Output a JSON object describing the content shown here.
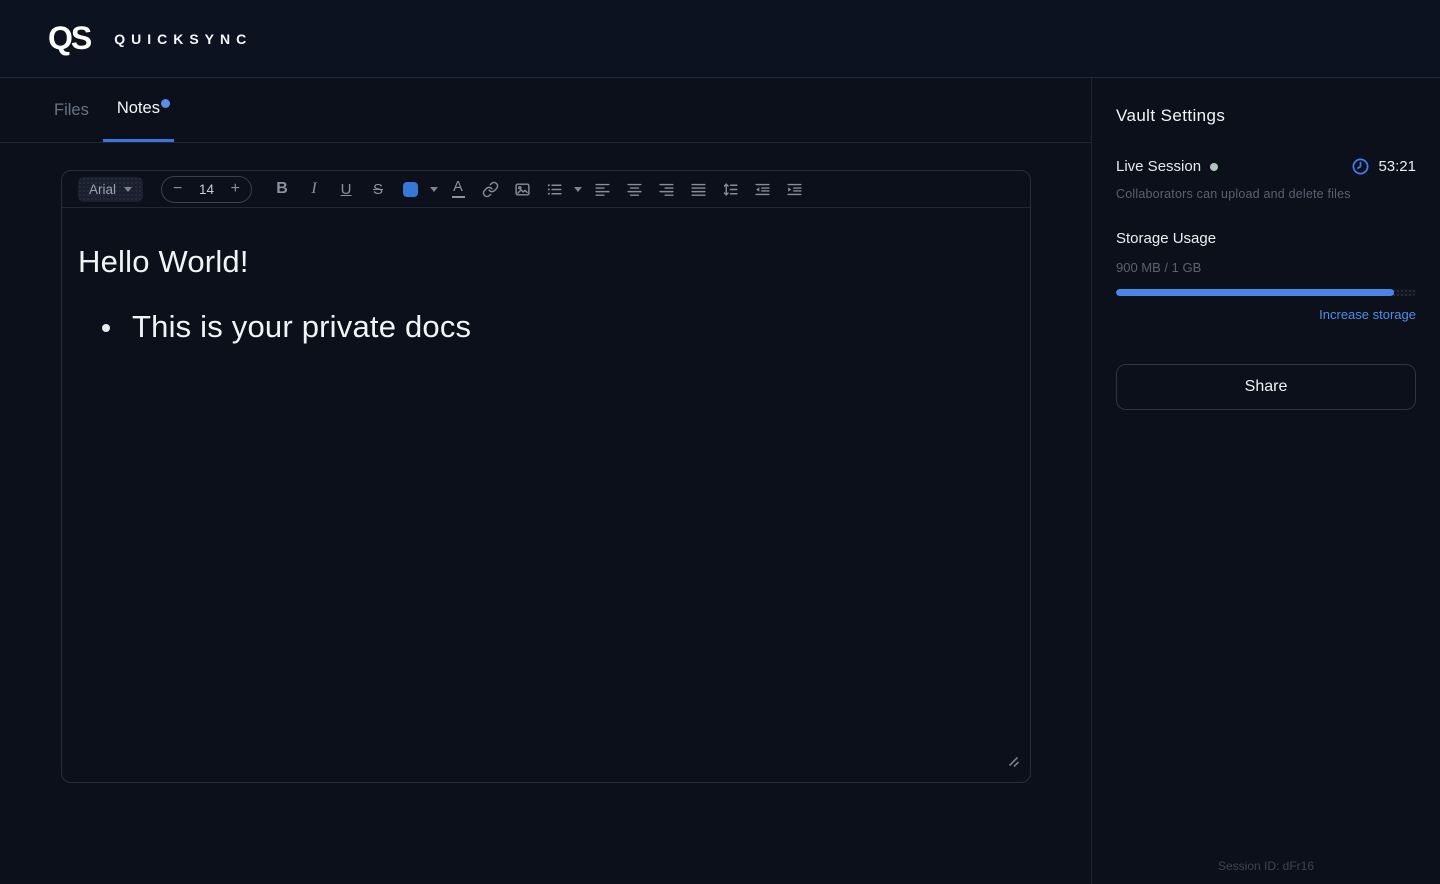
{
  "colors": {
    "accent_blue": "#3e74dd",
    "swatch_blue": "#3478d8",
    "notes_badge_blue": "#5b8def",
    "live_dot_green": "#a9c9b5",
    "link_blue": "#4d8fe8",
    "progress_fill_blue": "#4a86e8",
    "background": "#0b101a"
  },
  "header": {
    "logo_mark": "QS",
    "brand": "QUICKSYNC"
  },
  "tabs": {
    "files": "Files",
    "notes": "Notes"
  },
  "toolbar": {
    "font_family": "Arial",
    "font_size": "14",
    "decrease_label": "−",
    "increase_label": "+",
    "bold": "B",
    "italic": "I",
    "underline": "U",
    "strikethrough": "S",
    "text_color": "A",
    "icons": [
      "font-family-dropdown",
      "decrease-font-size",
      "increase-font-size",
      "bold",
      "italic",
      "underline",
      "strikethrough",
      "color-swatch",
      "color-swatch-dropdown",
      "text-color",
      "insert-link",
      "insert-image",
      "bullet-list",
      "bullet-list-dropdown",
      "align-left",
      "align-center",
      "align-right",
      "align-justify",
      "line-spacing",
      "outdent",
      "indent"
    ]
  },
  "document": {
    "heading": "Hello World!",
    "bullet": "This is your private docs"
  },
  "sidebar": {
    "title": "Vault Settings",
    "live_session_label": "Live Session",
    "timer": "53:21",
    "caption": "Collaborators can upload and delete files",
    "storage_label": "Storage Usage",
    "storage_usage": "900 MB / 1 GB",
    "storage_percent": 92.5,
    "increase_link": "Increase storage",
    "share_label": "Share",
    "session_id": "Session ID: dFr16"
  }
}
